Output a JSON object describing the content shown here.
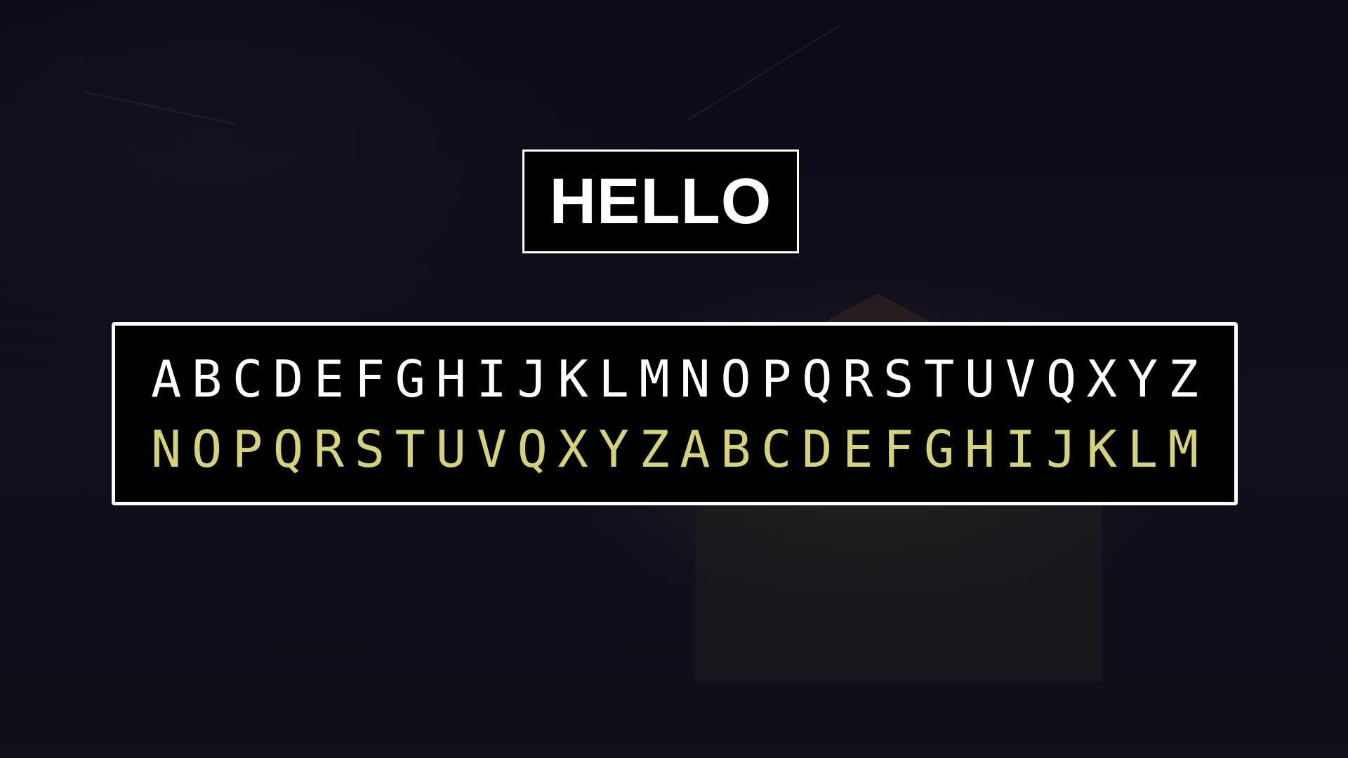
{
  "word": {
    "text": "HELLO"
  },
  "cipher_table": {
    "plain_alphabet": "ABCDEFGHIJKLMNOPQRSTUVQXYZ",
    "shifted_alphabet": "NOPQRSTUVQXYZABCDEFGHIJKLM"
  },
  "colors": {
    "background": "#0d0c17",
    "box_fill": "#000000",
    "box_border": "#ffffff",
    "plain_text": "#ffffff",
    "shifted_text": "#d4d27a"
  }
}
